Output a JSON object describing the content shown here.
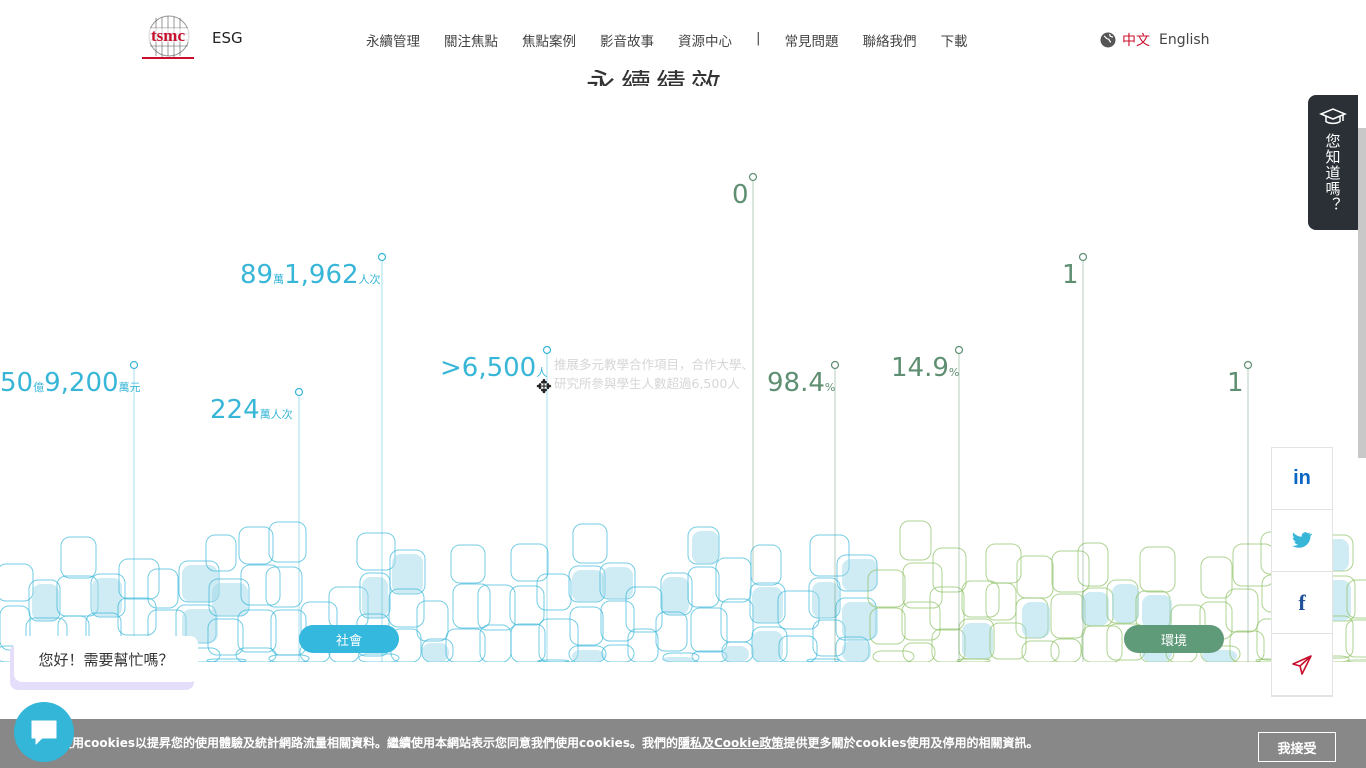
{
  "header": {
    "brand": "tsmc",
    "section": "ESG",
    "nav": [
      "永續管理",
      "關注焦點",
      "焦點案例",
      "影音故事",
      "資源中心",
      "|",
      "常見問題",
      "聯絡我們",
      "下載"
    ],
    "lang_current": "中文",
    "lang_other": "English"
  },
  "heading": "永續績效",
  "stats": [
    {
      "num": "50",
      "unit1": "億",
      "num2": "9,200",
      "unit2": "萬元",
      "color": "#38b6d8"
    },
    {
      "num": "224",
      "unit": "萬人次",
      "color": "#38b6d8"
    },
    {
      "num": "89",
      "unit1": "萬",
      "num2": "1,962",
      "unit2": "人次",
      "color": "#38b6d8"
    },
    {
      "num": ">6,500",
      "unit": "人",
      "color": "#38b6d8"
    },
    {
      "num": "0",
      "color": "#5f8f72"
    },
    {
      "num": "98.4",
      "unit": "%",
      "color": "#5f8f72"
    },
    {
      "num": "14.9",
      "unit": "%",
      "color": "#5f8f72"
    },
    {
      "num": "1",
      "color": "#5f8f72"
    },
    {
      "num": "1",
      "color": "#5f8f72"
    }
  ],
  "tooltip": "推展多元教學合作項目，合作大學、研究所參與學生人數超過6,500人",
  "pills": {
    "social": "社會",
    "environment": "環境"
  },
  "side_tab": {
    "label": "您知道嗎？",
    "icon": "graduation-cap-icon"
  },
  "share": [
    "linkedin-icon",
    "twitter-icon",
    "facebook-icon",
    "send-icon"
  ],
  "chat": {
    "greeting": "您好！需要幫忙嗎？"
  },
  "cookie": {
    "text_before": "使用cookies以提昇您的使用體驗及統計網路流量相關資料。繼續使用本網站表示您同意我們使用cookies。我們的",
    "link": "隱私及Cookie政策",
    "text_after": "提供更多關於cookies使用及停用的相關資訊。",
    "accept": "我接受"
  },
  "colors": {
    "blue": "#38b6d8",
    "green": "#5f8f72",
    "dark": "#2b3036",
    "brand": "#c8102e"
  }
}
